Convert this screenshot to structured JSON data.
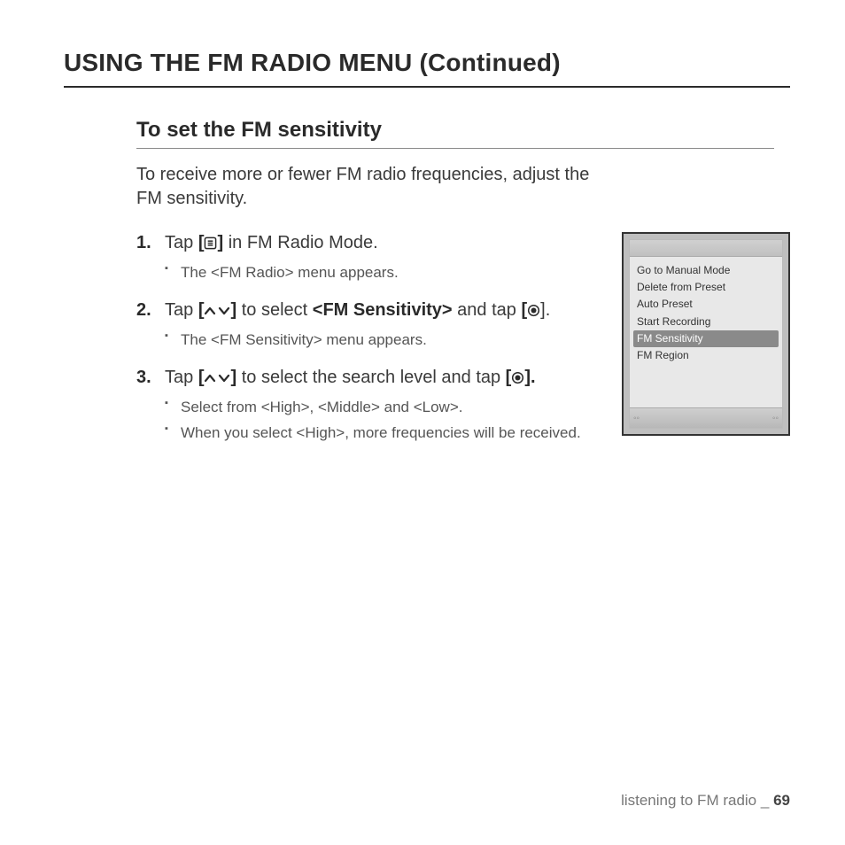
{
  "header": {
    "title": "USING THE FM RADIO MENU (Continued)"
  },
  "section": {
    "title": "To set the FM sensitivity",
    "intro": "To receive more or fewer FM radio frequencies, adjust the FM sensitivity."
  },
  "steps": [
    {
      "pre": "Tap ",
      "icon1": "menu",
      "post": " in FM Radio Mode.",
      "subs": [
        "The <FM Radio> menu appears."
      ]
    },
    {
      "pre": "Tap ",
      "icon1": "updown",
      "mid": " to select ",
      "bold": "<FM Sensitivity>",
      "post2": " and tap ",
      "icon2": "select",
      "tail": ".",
      "subs": [
        "The <FM Sensitivity> menu appears."
      ]
    },
    {
      "pre": "Tap ",
      "icon1": "updown",
      "mid": " to select the search level and tap ",
      "icon2": "select",
      "tail_bold": true,
      "tail": ".",
      "subs": [
        "Select from <High>, <Middle> and <Low>.",
        "When you select <High>, more frequencies will be received."
      ]
    }
  ],
  "device_menu": {
    "items": [
      {
        "label": "Go to Manual Mode",
        "selected": false
      },
      {
        "label": "Delete from Preset",
        "selected": false
      },
      {
        "label": "Auto Preset",
        "selected": false
      },
      {
        "label": "Start Recording",
        "selected": false
      },
      {
        "label": "FM Sensitivity",
        "selected": true
      },
      {
        "label": "FM Region",
        "selected": false
      }
    ]
  },
  "footer": {
    "chapter": "listening to FM radio",
    "sep": "_",
    "page": "69"
  }
}
